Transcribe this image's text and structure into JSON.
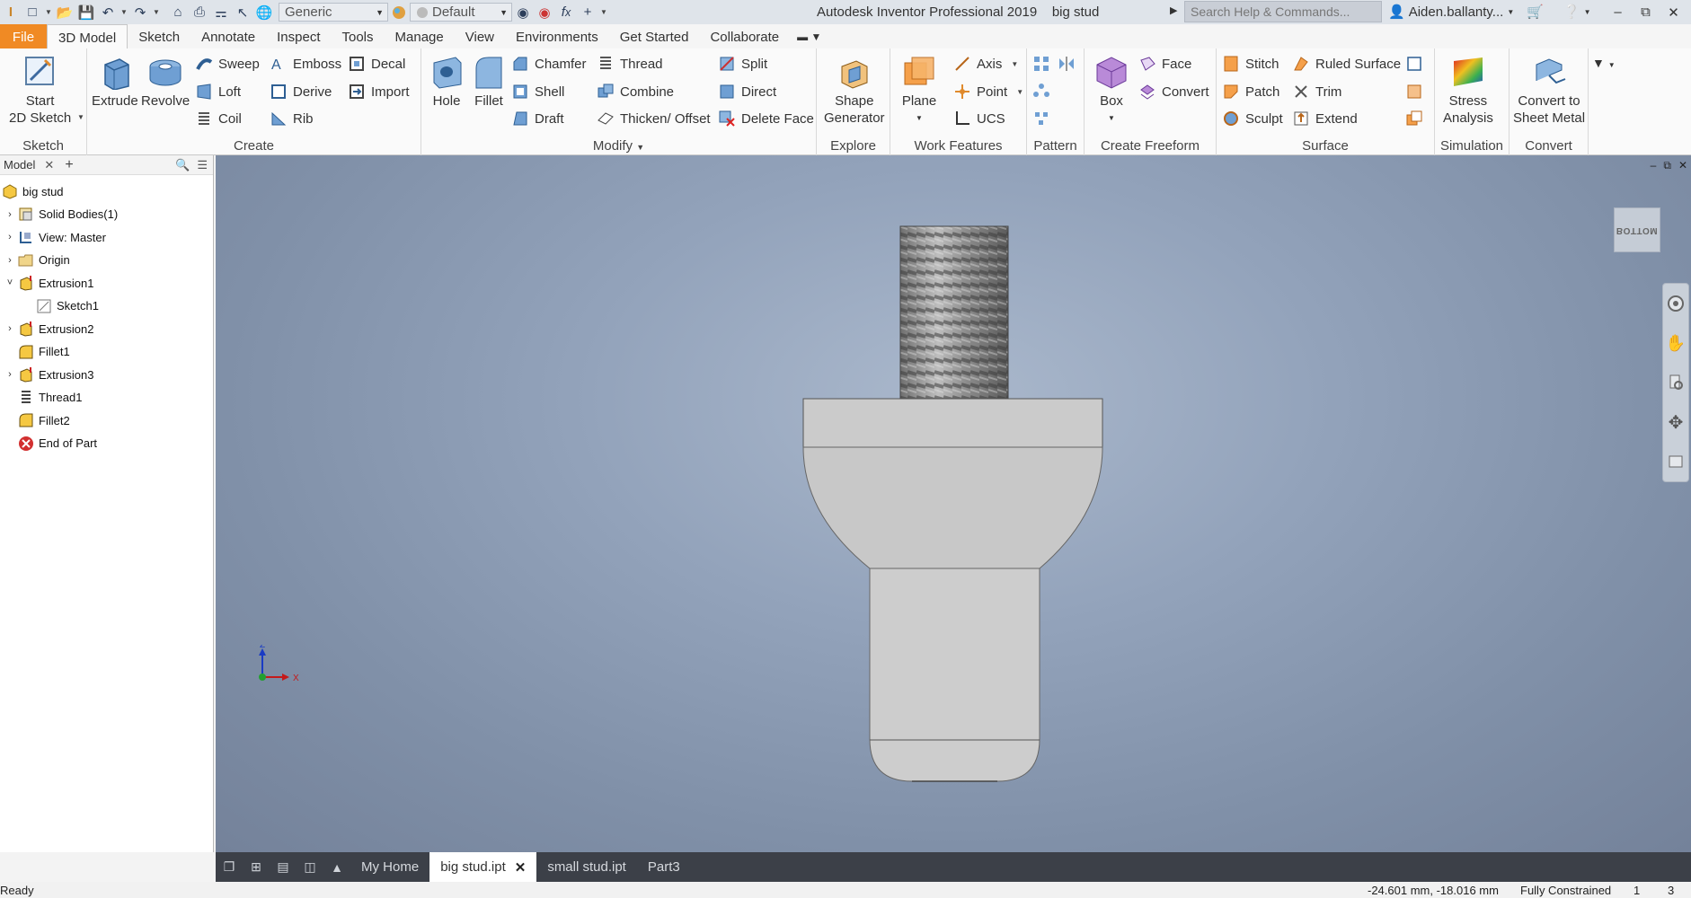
{
  "app": {
    "title": "Autodesk Inventor Professional 2019",
    "document": "big stud"
  },
  "quick_access": {
    "material": "Generic",
    "appearance": "Default"
  },
  "search": {
    "placeholder": "Search Help & Commands..."
  },
  "user": {
    "name": "Aiden.ballanty..."
  },
  "tabs": [
    "File",
    "3D Model",
    "Sketch",
    "Annotate",
    "Inspect",
    "Tools",
    "Manage",
    "View",
    "Environments",
    "Get Started",
    "Collaborate"
  ],
  "active_tab": "3D Model",
  "ribbon": {
    "sketch": {
      "title": "Sketch",
      "start_sketch_line1": "Start",
      "start_sketch_line2": "2D Sketch"
    },
    "create": {
      "title": "Create",
      "extrude": "Extrude",
      "revolve": "Revolve",
      "sweep": "Sweep",
      "loft": "Loft",
      "coil": "Coil",
      "emboss": "Emboss",
      "derive": "Derive",
      "rib": "Rib",
      "decal": "Decal",
      "import": "Import"
    },
    "modify": {
      "title": "Modify",
      "hole": "Hole",
      "fillet": "Fillet",
      "chamfer": "Chamfer",
      "shell": "Shell",
      "draft": "Draft",
      "thread": "Thread",
      "combine": "Combine",
      "thicken": "Thicken/ Offset",
      "split": "Split",
      "direct": "Direct",
      "delete_face": "Delete Face"
    },
    "explore": {
      "title": "Explore",
      "shape_gen_line1": "Shape",
      "shape_gen_line2": "Generator"
    },
    "work_features": {
      "title": "Work Features",
      "plane": "Plane",
      "axis": "Axis",
      "point": "Point",
      "ucs": "UCS"
    },
    "pattern": {
      "title": "Pattern"
    },
    "freeform": {
      "title": "Create Freeform",
      "box": "Box",
      "face": "Face",
      "convert": "Convert"
    },
    "surface": {
      "title": "Surface",
      "stitch": "Stitch",
      "patch": "Patch",
      "sculpt": "Sculpt",
      "ruled_surface": "Ruled Surface",
      "trim": "Trim",
      "extend": "Extend"
    },
    "simulation": {
      "title": "Simulation",
      "stress_line1": "Stress",
      "stress_line2": "Analysis"
    },
    "convert": {
      "title": "Convert",
      "sheet_line1": "Convert to",
      "sheet_line2": "Sheet Metal"
    }
  },
  "browser": {
    "tab_label": "Model",
    "tree": [
      {
        "label": "big stud",
        "icon": "part-icon",
        "expander": "",
        "level": 0
      },
      {
        "label": "Solid Bodies(1)",
        "icon": "solid-bodies-icon",
        "expander": "›",
        "level": 1
      },
      {
        "label": "View: Master",
        "icon": "view-icon",
        "expander": "›",
        "level": 1
      },
      {
        "label": "Origin",
        "icon": "folder-icon",
        "expander": "›",
        "level": 1
      },
      {
        "label": "Extrusion1",
        "icon": "extrusion-icon",
        "expander": "˅",
        "level": 1
      },
      {
        "label": "Sketch1",
        "icon": "sketch-icon",
        "expander": "",
        "level": 2
      },
      {
        "label": "Extrusion2",
        "icon": "extrusion-icon",
        "expander": "›",
        "level": 1
      },
      {
        "label": "Fillet1",
        "icon": "fillet-icon",
        "expander": "",
        "level": 1
      },
      {
        "label": "Extrusion3",
        "icon": "extrusion-icon",
        "expander": "›",
        "level": 1
      },
      {
        "label": "Thread1",
        "icon": "thread-icon",
        "expander": "",
        "level": 1
      },
      {
        "label": "Fillet2",
        "icon": "fillet-icon",
        "expander": "",
        "level": 1
      },
      {
        "label": "End of Part",
        "icon": "end-of-part-icon",
        "expander": "",
        "level": 1
      }
    ]
  },
  "viewport": {
    "viewcube_label": "BOTTOM",
    "triad": {
      "z": "Z",
      "x": "X"
    }
  },
  "doc_tabs": [
    {
      "label": "My Home",
      "active": false
    },
    {
      "label": "big stud.ipt",
      "active": true
    },
    {
      "label": "small stud.ipt",
      "active": false
    },
    {
      "label": "Part3",
      "active": false
    }
  ],
  "status": {
    "text": "Ready",
    "coords": "-24.601 mm, -18.016 mm",
    "constraint": "Fully Constrained",
    "count1": "1",
    "count2": "3"
  },
  "colors": {
    "file_tab": "#f08a24",
    "viewport_bg": "#93a3bb",
    "part_gray": "#c9c9c9"
  }
}
